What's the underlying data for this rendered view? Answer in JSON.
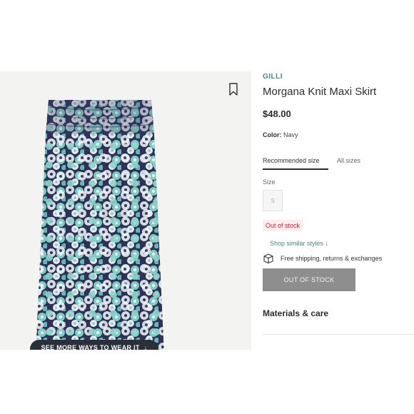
{
  "product": {
    "brand": "GILLI",
    "title": "Morgana Knit Maxi Skirt",
    "price": "$48.00",
    "color_label": "Color:",
    "color_value": "Navy"
  },
  "size_tabs": {
    "recommended": "Recommended size",
    "all": "All sizes"
  },
  "size": {
    "label": "Size",
    "options": [
      "S"
    ],
    "stock_status": "Out of stock"
  },
  "links": {
    "shop_similar": "Shop similar styles ↓"
  },
  "shipping": {
    "text": "Free shipping, returns & exchanges"
  },
  "buttons": {
    "out_of_stock": "OUT OF STOCK",
    "see_more": "SEE MORE WAYS TO WEAR IT"
  },
  "sections": {
    "materials": "Materials & care"
  },
  "colors": {
    "brand_accent": "#3a8f8a",
    "out_of_stock_red": "#c2263a",
    "disabled_button": "#8e8e8e",
    "skirt_navy": "#2e3257",
    "skirt_teal": "#7ecdc3"
  },
  "icons": [
    "bookmark-icon",
    "package-icon",
    "arrow-down-icon"
  ]
}
